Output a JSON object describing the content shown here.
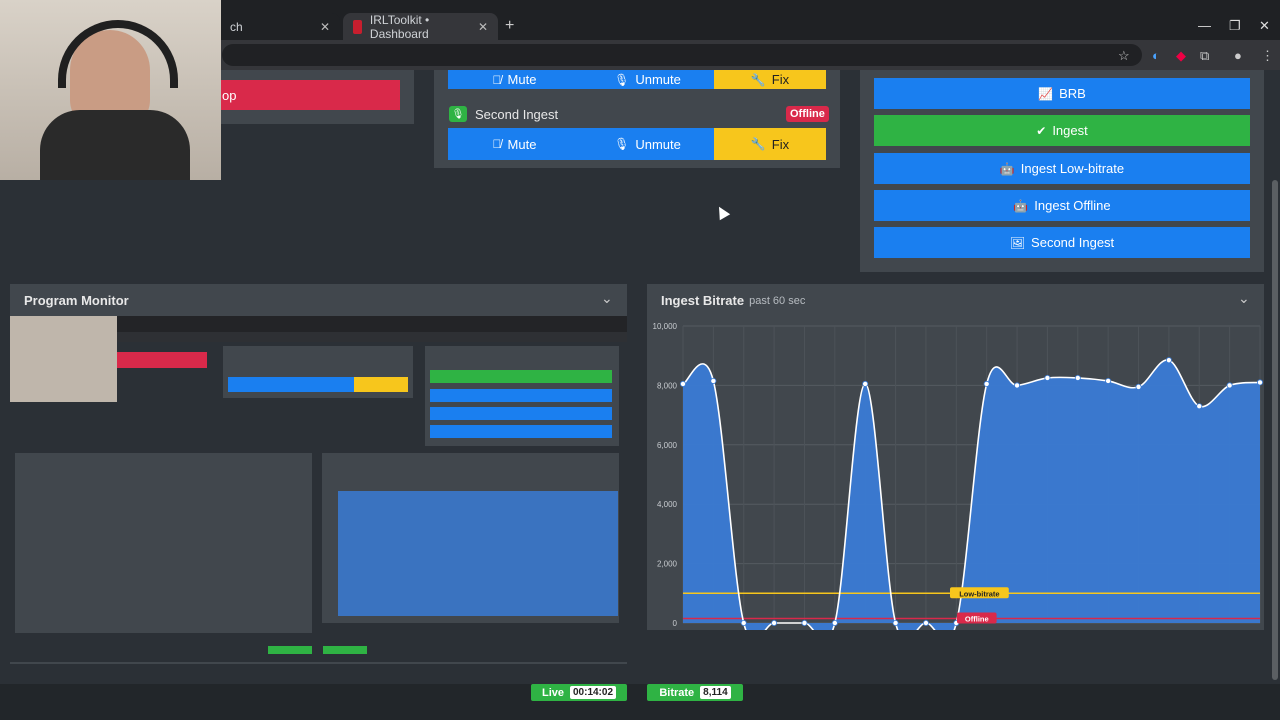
{
  "browser": {
    "tabs": [
      {
        "title": "ch"
      },
      {
        "title": "IRLToolkit • Dashboard"
      }
    ]
  },
  "top_left": {
    "stop_label": "op"
  },
  "controls": {
    "rows": [
      {
        "title": "",
        "mute": "Mute",
        "unmute": "Unmute",
        "fix": "Fix"
      },
      {
        "title": "Second Ingest",
        "badge": "Offline",
        "mute": "Mute",
        "unmute": "Unmute",
        "fix": "Fix"
      }
    ]
  },
  "scenes": {
    "items": [
      {
        "label": "BRB",
        "active": false
      },
      {
        "label": "Ingest",
        "active": true
      },
      {
        "label": "Ingest Low-bitrate",
        "active": false
      },
      {
        "label": "Ingest Offline",
        "active": false
      },
      {
        "label": "Second Ingest",
        "active": false
      }
    ]
  },
  "program_monitor": {
    "title": "Program Monitor"
  },
  "bitrate_panel": {
    "title": "Ingest Bitrate",
    "subtitle": "past 60 sec"
  },
  "chart_data": {
    "type": "area",
    "title": "Ingest Bitrate",
    "subtitle": "past 60 sec",
    "ylim": [
      0,
      10000
    ],
    "yticks": [
      "10,000",
      "8,000",
      "6,000",
      "4,000",
      "2,000",
      "0"
    ],
    "ytick_values": [
      10000,
      8000,
      6000,
      4000,
      2000,
      0
    ],
    "x": [
      0,
      1,
      2,
      3,
      4,
      5,
      6,
      7,
      8,
      9,
      10,
      11,
      12,
      13,
      14,
      15,
      16,
      17,
      18,
      19
    ],
    "values": [
      8050,
      8150,
      0,
      0,
      0,
      0,
      8050,
      0,
      0,
      0,
      8050,
      8000,
      8250,
      8250,
      8150,
      7950,
      8850,
      7300,
      8000,
      8100
    ],
    "thresholds": [
      {
        "label": "Low-bitrate",
        "value": 1000,
        "color": "#f7c61c"
      },
      {
        "label": "Offline",
        "value": 150,
        "color": "#d9294a"
      }
    ],
    "fill_color": "#3a7bd5",
    "line_color": "#ffffff"
  },
  "status_bar": {
    "live_label": "Live",
    "live_value": "00:14:02",
    "bitrate_label": "Bitrate",
    "bitrate_value": "8,114"
  },
  "colors": {
    "primary": "#1a7ff0",
    "success": "#2fb344",
    "warning": "#f7c61c",
    "danger": "#d9294a",
    "panel": "#41474d",
    "background": "#2b3036"
  }
}
